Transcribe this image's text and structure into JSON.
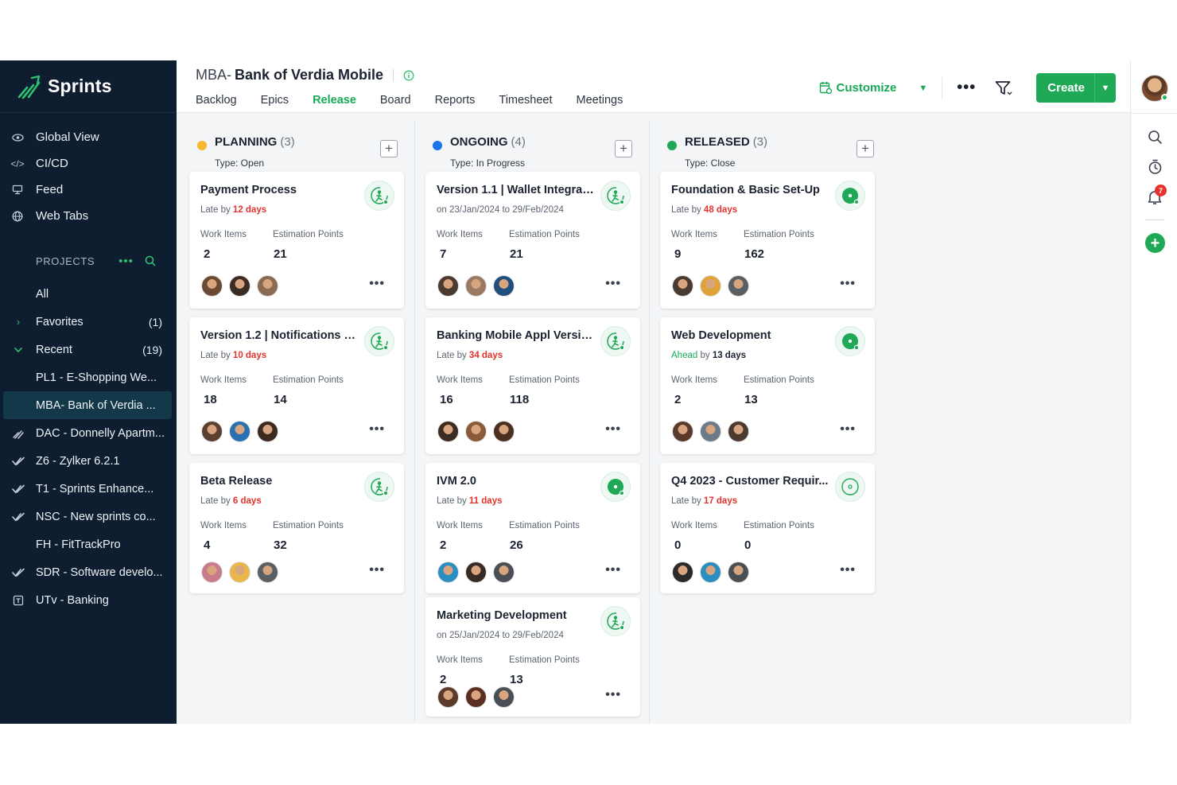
{
  "app": {
    "name": "Sprints",
    "project_prefix": "MBA-",
    "project_title": "Bank of Verdia Mobile"
  },
  "sidebar": {
    "nav": [
      {
        "label": "Global View",
        "icon": "eye-icon"
      },
      {
        "label": "CI/CD",
        "icon": "code-icon"
      },
      {
        "label": "Feed",
        "icon": "feed-icon"
      },
      {
        "label": "Web Tabs",
        "icon": "globe-icon"
      }
    ],
    "projects_header": "PROJECTS",
    "projects": [
      {
        "label": "All",
        "lead": "",
        "count": ""
      },
      {
        "label": "Favorites",
        "lead": "chevron-right-icon",
        "count": "(1)"
      },
      {
        "label": "Recent",
        "lead": "chevron-down-icon",
        "count": "(19)"
      },
      {
        "label": "PL1  - E-Shopping We...",
        "lead": "",
        "count": ""
      },
      {
        "label": "MBA- Bank of Verdia ...",
        "lead": "",
        "count": "",
        "active": true
      },
      {
        "label": "DAC  - Donnelly Apartm...",
        "lead": "feather-icon",
        "count": ""
      },
      {
        "label": "Z6   - Zylker 6.2.1",
        "lead": "double-check-icon",
        "count": ""
      },
      {
        "label": "T1   - Sprints Enhance...",
        "lead": "double-check-icon",
        "count": ""
      },
      {
        "label": "NSC  - New sprints co...",
        "lead": "double-check-icon",
        "count": ""
      },
      {
        "label": "FH   - FitTrackPro",
        "lead": "",
        "count": ""
      },
      {
        "label": "SDR  - Software develo...",
        "lead": "double-check-icon",
        "count": ""
      },
      {
        "label": "UTv  - Banking",
        "lead": "box-icon",
        "count": ""
      }
    ]
  },
  "header": {
    "tabs": [
      "Backlog",
      "Epics",
      "Release",
      "Board",
      "Reports",
      "Timesheet",
      "Meetings"
    ],
    "active_tab": "Release",
    "customize_label": "Customize",
    "create_label": "Create"
  },
  "rail": {
    "notification_count": "7"
  },
  "colors": {
    "accent": "#1fa855",
    "sidebar_bg": "#0e1e30",
    "late": "#e5322d",
    "planning": "#f5b82e",
    "ongoing": "#1a73e8",
    "released": "#1fa855"
  },
  "columns": [
    {
      "name": "PLANNING",
      "count": "(3)",
      "type": "Type: Open",
      "dot_color": "#f5b82e",
      "cards": [
        {
          "title": "Payment Process",
          "status_prefix": "Late by ",
          "status_days": "12 days",
          "status_kind": "late",
          "work_label": "Work Items",
          "est_label": "Estimation Points",
          "work_items": "2",
          "points": "21",
          "icon": "person-run-icon"
        },
        {
          "title": "Version 1.2 | Notifications U...",
          "status_prefix": "Late by ",
          "status_days": "10 days",
          "status_kind": "late",
          "work_label": "Work Items",
          "est_label": "Estimation Points",
          "work_items": "18",
          "points": "14",
          "icon": "person-run-icon"
        },
        {
          "title": "Beta Release",
          "status_prefix": "Late by ",
          "status_days": "6 days",
          "status_kind": "late",
          "work_label": "Work Items",
          "est_label": "Estimation Points",
          "work_items": "4",
          "points": "32",
          "icon": "person-run-icon"
        }
      ]
    },
    {
      "name": "ONGOING",
      "count": "(4)",
      "type": "Type: In Progress",
      "dot_color": "#1a73e8",
      "cards": [
        {
          "title": "Version 1.1 | Wallet Integrat...",
          "status_prefix": "on 23/Jan/2024 to 29/Feb/2024",
          "status_days": "",
          "status_kind": "date",
          "work_label": "Work Items",
          "est_label": "Estimation Points",
          "work_items": "7",
          "points": "21",
          "icon": "person-run-icon"
        },
        {
          "title": "Banking Mobile Appl Versio...",
          "status_prefix": "Late by ",
          "status_days": "34 days",
          "status_kind": "late",
          "work_label": "Work Items",
          "est_label": "Estimation Points",
          "work_items": "16",
          "points": "118",
          "icon": "person-run-icon"
        },
        {
          "title": "IVM 2.0",
          "status_prefix": "Late by ",
          "status_days": "11 days",
          "status_kind": "late",
          "work_label": "Work Items",
          "est_label": "Estimation Points",
          "work_items": "2",
          "points": "26",
          "icon": "released-disc-icon"
        },
        {
          "title": "Marketing Development",
          "status_prefix": "on 25/Jan/2024 to 29/Feb/2024",
          "status_days": "",
          "status_kind": "date",
          "work_label": "Work Items",
          "est_label": "Estimation Points",
          "work_items": "2",
          "points": "13",
          "icon": "person-run-icon"
        }
      ]
    },
    {
      "name": "RELEASED",
      "count": "(3)",
      "type": "Type: Close",
      "dot_color": "#1fa855",
      "cards": [
        {
          "title": "Foundation & Basic Set-Up",
          "status_prefix": "Late by ",
          "status_days": "48 days",
          "status_kind": "late",
          "work_label": "Work Items",
          "est_label": "Estimation Points",
          "work_items": "9",
          "points": "162",
          "icon": "released-disc-icon"
        },
        {
          "title": "Web Development",
          "status_prefix": "Ahead",
          "status_mid": " by ",
          "status_days": "13 days",
          "status_kind": "ahead",
          "work_label": "Work Items",
          "est_label": "Estimation Points",
          "work_items": "2",
          "points": "13",
          "icon": "released-disc-icon"
        },
        {
          "title": "Q4 2023 - Customer Requir...",
          "status_prefix": "Late by ",
          "status_days": "17 days",
          "status_kind": "late",
          "work_label": "Work Items",
          "est_label": "Estimation Points",
          "work_items": "0",
          "points": "0",
          "icon": "target-icon"
        }
      ]
    }
  ]
}
